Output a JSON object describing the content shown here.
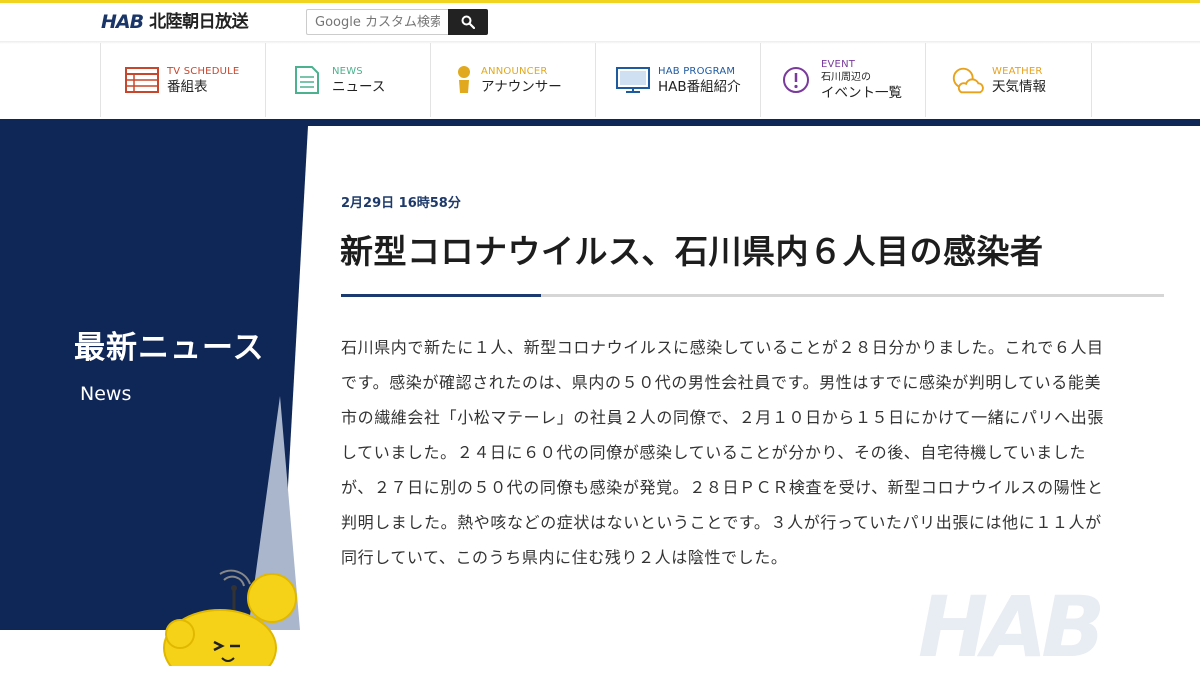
{
  "header": {
    "logo_mark": "HAB",
    "logo_name": "北陸朝日放送",
    "search_placeholder": "Google カスタム検索"
  },
  "nav": [
    {
      "en": "TV SCHEDULE",
      "ja": "番組表",
      "icon": "calendar-grid-icon",
      "color": "#c8462c"
    },
    {
      "en": "NEWS",
      "ja": "ニュース",
      "icon": "document-icon",
      "color": "#4cb18e"
    },
    {
      "en": "ANNOUNCER",
      "ja": "アナウンサー",
      "icon": "person-icon",
      "color": "#e0a91e"
    },
    {
      "en": "HAB PROGRAM",
      "ja": "HAB番組紹介",
      "icon": "monitor-icon",
      "color": "#1e5aa0"
    },
    {
      "en": "EVENT",
      "sub": "石川周辺の",
      "ja": "イベント一覧",
      "icon": "alert-circle-icon",
      "color": "#7a3a9c"
    },
    {
      "en": "WEATHER",
      "ja": "天気情報",
      "icon": "sun-cloud-icon",
      "color": "#e8a21c"
    }
  ],
  "sidebar": {
    "title": "最新ニュース",
    "subtitle": "News"
  },
  "article": {
    "date": "2月29日 16時58分",
    "title": "新型コロナウイルス、石川県内６人目の感染者",
    "body": "石川県内で新たに１人、新型コロナウイルスに感染していることが２８日分かりました。これで６人目です。感染が確認されたのは、県内の５０代の男性会社員です。男性はすでに感染が判明している能美市の繊維会社「小松マテーレ」の社員２人の同僚で、２月１０日から１５日にかけて一緒にパリへ出張していました。２４日に６０代の同僚が感染していることが分かり、その後、自宅待機していましたが、２７日に別の５０代の同僚も感染が発覚。２８日ＰＣＲ検査を受け、新型コロナウイルスの陽性と判明しました。熱や咳などの症状はないということです。３人が行っていたパリ出張には他に１１人が同行していて、このうち県内に住む残り２人は陰性でした。"
  },
  "watermark": "HAB",
  "colors": {
    "navy": "#0f2757",
    "accent_yellow": "#f0d41f",
    "date_blue": "#1e3a6a"
  }
}
